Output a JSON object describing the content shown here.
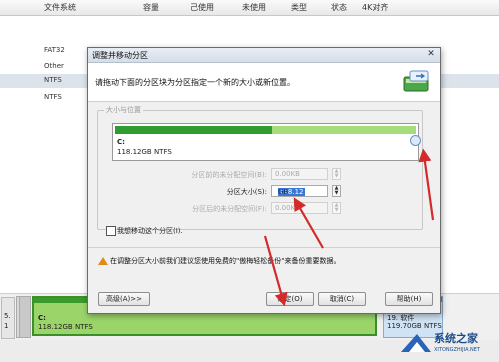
{
  "background_app": {
    "columns": [
      "文件系统",
      "容量",
      "己使用",
      "未使用",
      "类型",
      "状态",
      "4K对齐"
    ],
    "rows": [
      "FAT32",
      "Other",
      "NTFS",
      "NTFS"
    ],
    "disk_left_labels": [
      "5.",
      "1"
    ],
    "part_c": {
      "label": "C:",
      "size": "118.12GB NTFS"
    },
    "part_d": {
      "label": "19. 软件",
      "size": "119.70GB NTFS"
    }
  },
  "dialog": {
    "title": "调整并移动分区",
    "close_glyph": "✕",
    "instruction": "请拖动下面的分区块为分区指定一个新的大小或新位置。",
    "group_title": "大小与位置",
    "partition_label": "C:",
    "partition_size_text": "118.12GB NTFS",
    "bar_used_fraction": 0.52,
    "fields": {
      "free_before_label": "分区前的未分配空间(B):",
      "free_before_value": "0.00KB",
      "size_label": "分区大小(S):",
      "size_value": "118.12",
      "size_unit": "GB",
      "free_after_label": "分区后的未分配空间(F):",
      "free_after_value": "0.00KB"
    },
    "checkbox_label": "我想移动这个分区(I).",
    "warning": "在调整分区大小前我们建议您使用免费的\"傲梅轻松备份\"来备份重要数据。",
    "buttons": {
      "advanced": "高级(A)>>",
      "ok": "确定(O)",
      "cancel": "取消(C)",
      "help": "帮助(H)"
    }
  },
  "watermark": {
    "text": "系统之家",
    "url": "XITONGZHIJIA.NET"
  },
  "colors": {
    "used": "#2e9c2e",
    "free": "#a6dd7c",
    "arrow": "#d42a2a",
    "selection": "#3877d6"
  }
}
